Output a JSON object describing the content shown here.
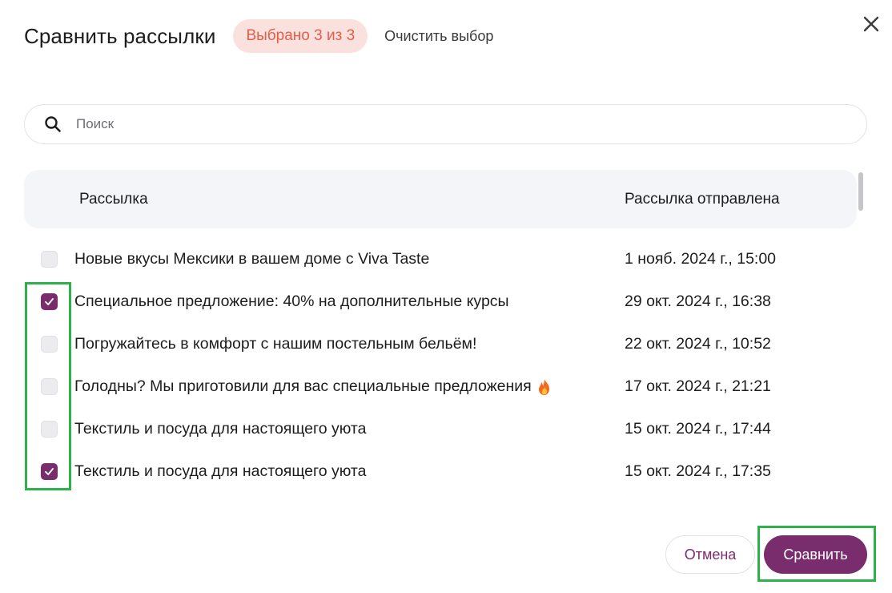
{
  "dialog": {
    "title": "Сравнить рассылки",
    "selected_badge": "Выбрано 3 из 3",
    "clear_label": "Очистить выбор",
    "close_icon": "close-icon"
  },
  "search": {
    "placeholder": "Поиск",
    "value": ""
  },
  "table": {
    "headers": {
      "name": "Рассылка",
      "date": "Рассылка отправлена"
    },
    "rows": [
      {
        "name": "Новые вкусы Мексики в вашем доме с Viva Taste",
        "date": "1 нояб. 2024 г., 15:00",
        "checked": false
      },
      {
        "name": "Специальное предложение: 40% на дополнительные курсы",
        "date": "29 окт. 2024 г., 16:38",
        "checked": true
      },
      {
        "name": "Погружайтесь в комфорт с нашим постельным бельём!",
        "date": "22 окт. 2024 г., 10:52",
        "checked": false
      },
      {
        "name": "Голодны? Мы приготовили для вас специальные предложения",
        "date": "17 окт. 2024 г., 21:21",
        "checked": false,
        "emoji": "🔥"
      },
      {
        "name": "Текстиль и посуда для настоящего уюта",
        "date": "15 окт. 2024 г., 17:44",
        "checked": false
      },
      {
        "name": "Текстиль и посуда для настоящего уюта",
        "date": "15 окт. 2024 г., 17:35",
        "checked": true
      }
    ]
  },
  "footer": {
    "cancel_label": "Отмена",
    "compare_label": "Сравнить"
  },
  "colors": {
    "accent": "#7a2d6d",
    "badge_bg": "#fbe1dd",
    "badge_text": "#e25e4a",
    "highlight": "#2fb14a"
  }
}
